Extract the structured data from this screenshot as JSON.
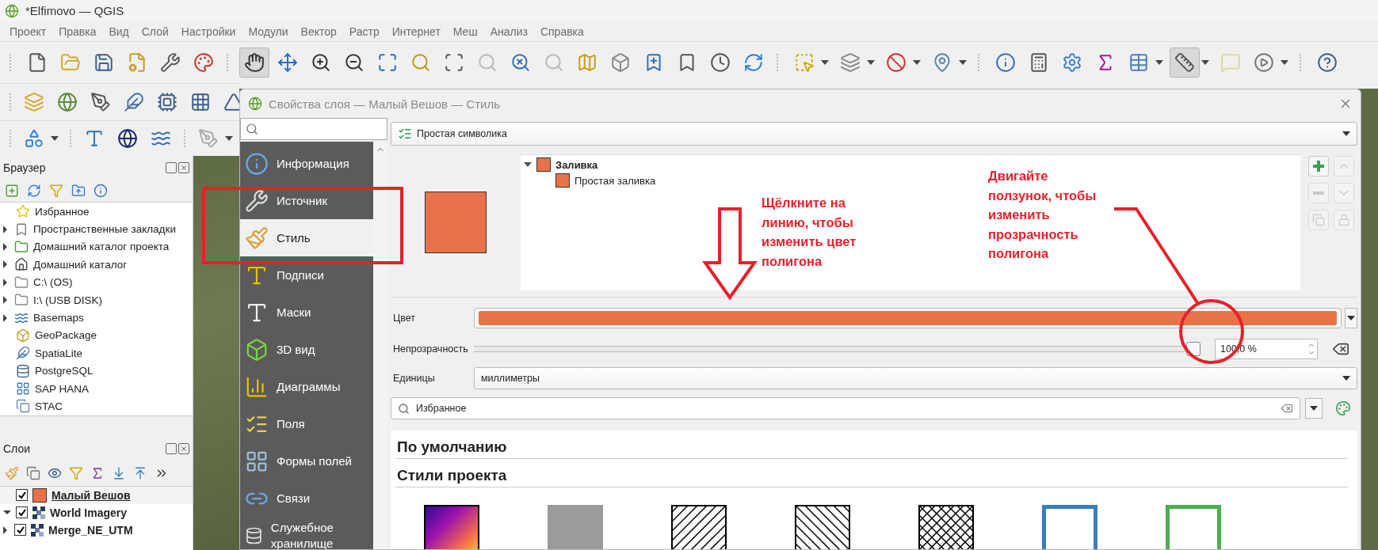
{
  "window": {
    "title": "*Elfimovo — QGIS"
  },
  "menu": [
    "Проект",
    "Правка",
    "Вид",
    "Слой",
    "Настройки",
    "Модули",
    "Вектор",
    "Растр",
    "Интернет",
    "Меш",
    "Анализ",
    "Справка"
  ],
  "main_toolbar": [
    {
      "pressed": false,
      "disabled": false
    },
    {
      "pressed": false,
      "disabled": false
    },
    {
      "pressed": false,
      "disabled": false
    },
    {
      "pressed": false,
      "disabled": false
    },
    {
      "pressed": false,
      "disabled": false
    },
    {
      "pressed": false,
      "disabled": false
    },
    {
      "pressed": true,
      "disabled": false
    },
    {
      "pressed": false,
      "disabled": false
    },
    {
      "pressed": false,
      "disabled": false
    },
    {
      "pressed": false,
      "disabled": false
    },
    {
      "pressed": false,
      "disabled": false
    },
    {
      "pressed": false,
      "disabled": false
    },
    {
      "pressed": false,
      "disabled": false
    },
    {
      "pressed": false,
      "disabled": true
    },
    {
      "pressed": false,
      "disabled": false
    },
    {
      "pressed": false,
      "disabled": true
    },
    {
      "pressed": false,
      "disabled": false
    },
    {
      "pressed": false,
      "disabled": false
    },
    {
      "pressed": false,
      "disabled": false
    },
    {
      "pressed": false,
      "disabled": false
    },
    {
      "pressed": false,
      "disabled": false
    },
    {
      "pressed": false,
      "disabled": false
    },
    {
      "pressed": false,
      "disabled": false
    },
    {
      "pressed": false,
      "disabled": false
    },
    {
      "pressed": false,
      "disabled": false
    },
    {
      "pressed": false,
      "disabled": false
    },
    {
      "pressed": false,
      "disabled": false
    },
    {
      "pressed": false,
      "disabled": false
    },
    {
      "pressed": false,
      "disabled": false
    },
    {
      "pressed": false,
      "disabled": false
    },
    {
      "pressed": false,
      "disabled": false
    },
    {
      "pressed": true,
      "disabled": false
    },
    {
      "pressed": false,
      "disabled": true
    },
    {
      "pressed": false,
      "disabled": false
    }
  ],
  "browser": {
    "title": "Браузер",
    "items": [
      {
        "label": "Избранное",
        "expandable": false
      },
      {
        "label": "Пространственные закладки",
        "expandable": true
      },
      {
        "label": "Домашний каталог проекта",
        "expandable": true
      },
      {
        "label": "Домашний каталог",
        "expandable": true
      },
      {
        "label": "C:\\ (OS)",
        "expandable": true
      },
      {
        "label": "I:\\ (USB DISK)",
        "expandable": true
      },
      {
        "label": "Basemaps",
        "expandable": true
      },
      {
        "label": "GeoPackage",
        "expandable": false
      },
      {
        "label": "SpatiaLite",
        "expandable": false
      },
      {
        "label": "PostgreSQL",
        "expandable": false
      },
      {
        "label": "SAP HANA",
        "expandable": false
      },
      {
        "label": "STAC",
        "expandable": false
      }
    ]
  },
  "layers": {
    "title": "Слои",
    "items": [
      {
        "name": "Малый Вешов",
        "kind": "polygon",
        "checked": true,
        "selected": true,
        "expandable": false
      },
      {
        "name": "World Imagery",
        "kind": "raster",
        "checked": true,
        "selected": false,
        "expandable": true,
        "expanded": true
      },
      {
        "name": "Merge_NE_UTM",
        "kind": "raster",
        "checked": true,
        "selected": false,
        "expandable": true,
        "expanded": false
      }
    ]
  },
  "dialog": {
    "title": "Свойства слоя — Малый Вешов — Стиль",
    "sidebar": [
      {
        "label": "Информация",
        "selected": false
      },
      {
        "label": "Источник",
        "selected": false
      },
      {
        "label": "Стиль",
        "selected": true
      },
      {
        "label": "Подписи",
        "selected": false
      },
      {
        "label": "Маски",
        "selected": false
      },
      {
        "label": "3D вид",
        "selected": false
      },
      {
        "label": "Диаграммы",
        "selected": false
      },
      {
        "label": "Поля",
        "selected": false
      },
      {
        "label": "Формы полей",
        "selected": false
      },
      {
        "label": "Связи",
        "selected": false
      },
      {
        "label": "Служебное хранилище",
        "selected": false
      }
    ],
    "renderer": "Простая символика",
    "symbol_tree": [
      {
        "label": "Заливка",
        "expanded": true,
        "children": [
          {
            "label": "Простая заливка"
          }
        ]
      }
    ],
    "color": {
      "label": "Цвет",
      "color": "#e8734a"
    },
    "opacity": {
      "label": "Непрозрачность",
      "level": 1,
      "reading": "100,0 %"
    },
    "units": {
      "label": "Единицы",
      "value": "миллиметры"
    },
    "style_search": {
      "value": "Избранное"
    },
    "groups": [
      "По умолчанию",
      "Стили проекта"
    ],
    "styles": [
      {
        "kind": "gradient"
      },
      {
        "kind": "solid",
        "color": "#9b9b9b"
      },
      {
        "kind": "hatch"
      },
      {
        "kind": "back_hatch"
      },
      {
        "kind": "cross_hatch"
      },
      {
        "kind": "outline",
        "color": "#3a7dbf"
      },
      {
        "kind": "outline",
        "color": "#4cae4c"
      }
    ]
  },
  "callouts": [
    {
      "text": "Щёлкните на\nлинию, чтобы\nизменить цвет\nполигона"
    },
    {
      "text": "Двигайте\nползунок, чтобы\nизменить\nпрозрачность\nполигона"
    }
  ]
}
